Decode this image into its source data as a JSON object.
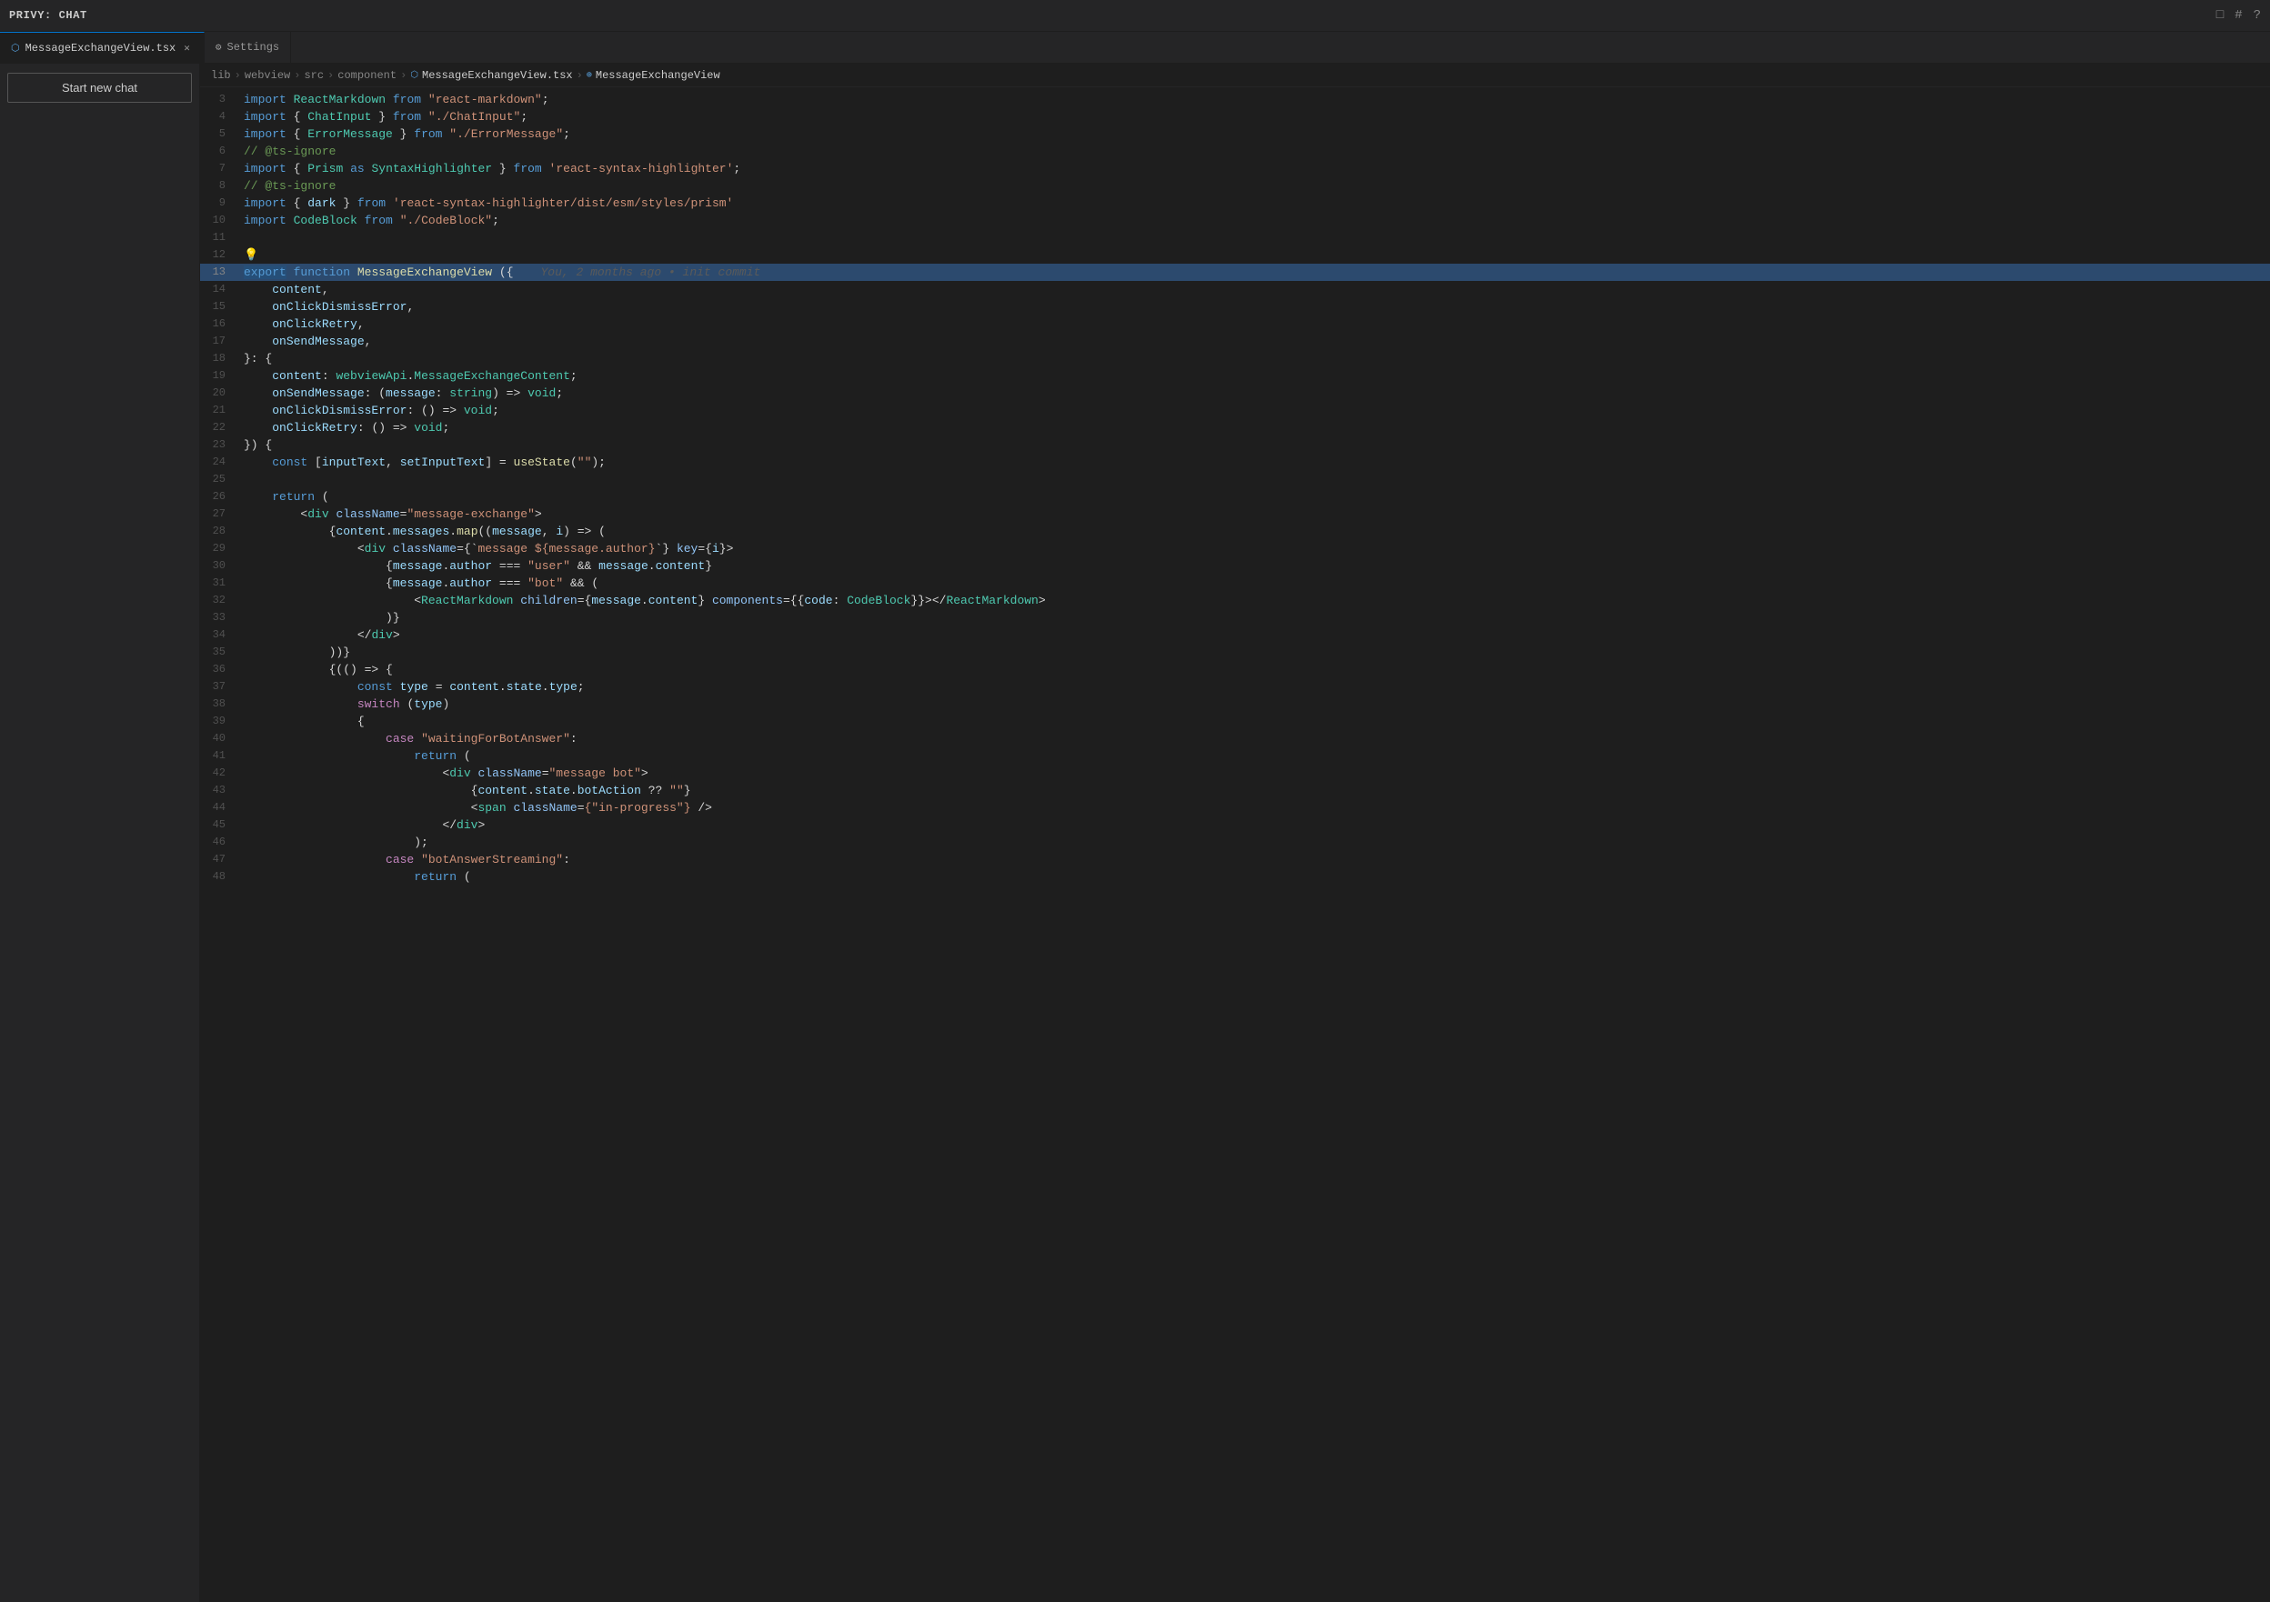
{
  "app": {
    "title": "PRIVY: CHAT"
  },
  "titlebar": {
    "icons": [
      "chat-icon",
      "grid-icon",
      "help-icon"
    ]
  },
  "tabs": [
    {
      "id": "tab-message-exchange",
      "label": "MessageExchangeView.tsx",
      "icon": "tsx-icon",
      "active": true,
      "closeable": true
    },
    {
      "id": "tab-settings",
      "label": "Settings",
      "icon": "settings-icon",
      "active": false,
      "closeable": false
    }
  ],
  "breadcrumb": {
    "items": [
      "lib",
      "webview",
      "src",
      "component",
      "MessageExchangeView.tsx",
      "MessageExchangeView"
    ]
  },
  "sidebar": {
    "new_chat_label": "Start new chat"
  },
  "editor": {
    "lines": [
      {
        "num": 3,
        "content": "import_reactmarkdown_line"
      },
      {
        "num": 4,
        "content": "import_chatinput_line"
      },
      {
        "num": 5,
        "content": "import_errormessage_line"
      },
      {
        "num": 6,
        "content": "comment_ts_ignore_1"
      },
      {
        "num": 7,
        "content": "import_prism_line"
      },
      {
        "num": 8,
        "content": "comment_ts_ignore_2"
      },
      {
        "num": 9,
        "content": "import_dark_line"
      },
      {
        "num": 10,
        "content": "import_codeblock_line"
      },
      {
        "num": 11,
        "content": "blank"
      },
      {
        "num": 12,
        "content": "blank"
      },
      {
        "num": 13,
        "content": "export_function_line"
      },
      {
        "num": 14,
        "content": "content_line"
      },
      {
        "num": 15,
        "content": "onclick_dismiss_line"
      },
      {
        "num": 16,
        "content": "onclick_retry_line"
      },
      {
        "num": 17,
        "content": "onsend_message_line"
      },
      {
        "num": 18,
        "content": "closing_brace_colon"
      },
      {
        "num": 19,
        "content": "content_type_line"
      },
      {
        "num": 20,
        "content": "onsend_type_line"
      },
      {
        "num": 21,
        "content": "onclick_dismiss_type_line"
      },
      {
        "num": 22,
        "content": "onclick_retry_type_line"
      },
      {
        "num": 23,
        "content": "closing_bracket_brace"
      },
      {
        "num": 24,
        "content": "const_input_text_line"
      },
      {
        "num": 25,
        "content": "blank"
      },
      {
        "num": 26,
        "content": "return_open_line"
      },
      {
        "num": 27,
        "content": "div_message_exchange_line"
      },
      {
        "num": 28,
        "content": "content_messages_map_line"
      },
      {
        "num": 29,
        "content": "div_classname_message_line"
      },
      {
        "num": 30,
        "content": "message_author_user_line"
      },
      {
        "num": 31,
        "content": "message_author_bot_line"
      },
      {
        "num": 32,
        "content": "reactmarkdown_line"
      },
      {
        "num": 33,
        "content": "closing_paren_line"
      },
      {
        "num": 34,
        "content": "closing_div_line"
      },
      {
        "num": 35,
        "content": "closing_triple_line"
      },
      {
        "num": 36,
        "content": "iife_open_line"
      },
      {
        "num": 37,
        "content": "const_type_line"
      },
      {
        "num": 38,
        "content": "switch_type_line"
      },
      {
        "num": 39,
        "content": "opening_brace_line"
      },
      {
        "num": 40,
        "content": "case_waiting_line"
      },
      {
        "num": 41,
        "content": "return_open_2"
      },
      {
        "num": 42,
        "content": "div_message_bot_line"
      },
      {
        "num": 43,
        "content": "bot_action_line"
      },
      {
        "num": 44,
        "content": "span_in_progress_line"
      },
      {
        "num": 45,
        "content": "closing_div_2"
      },
      {
        "num": 46,
        "content": "semicolon_line"
      },
      {
        "num": 47,
        "content": "case_bot_answer_streaming_line"
      },
      {
        "num": 48,
        "content": "return_open_3"
      }
    ]
  }
}
